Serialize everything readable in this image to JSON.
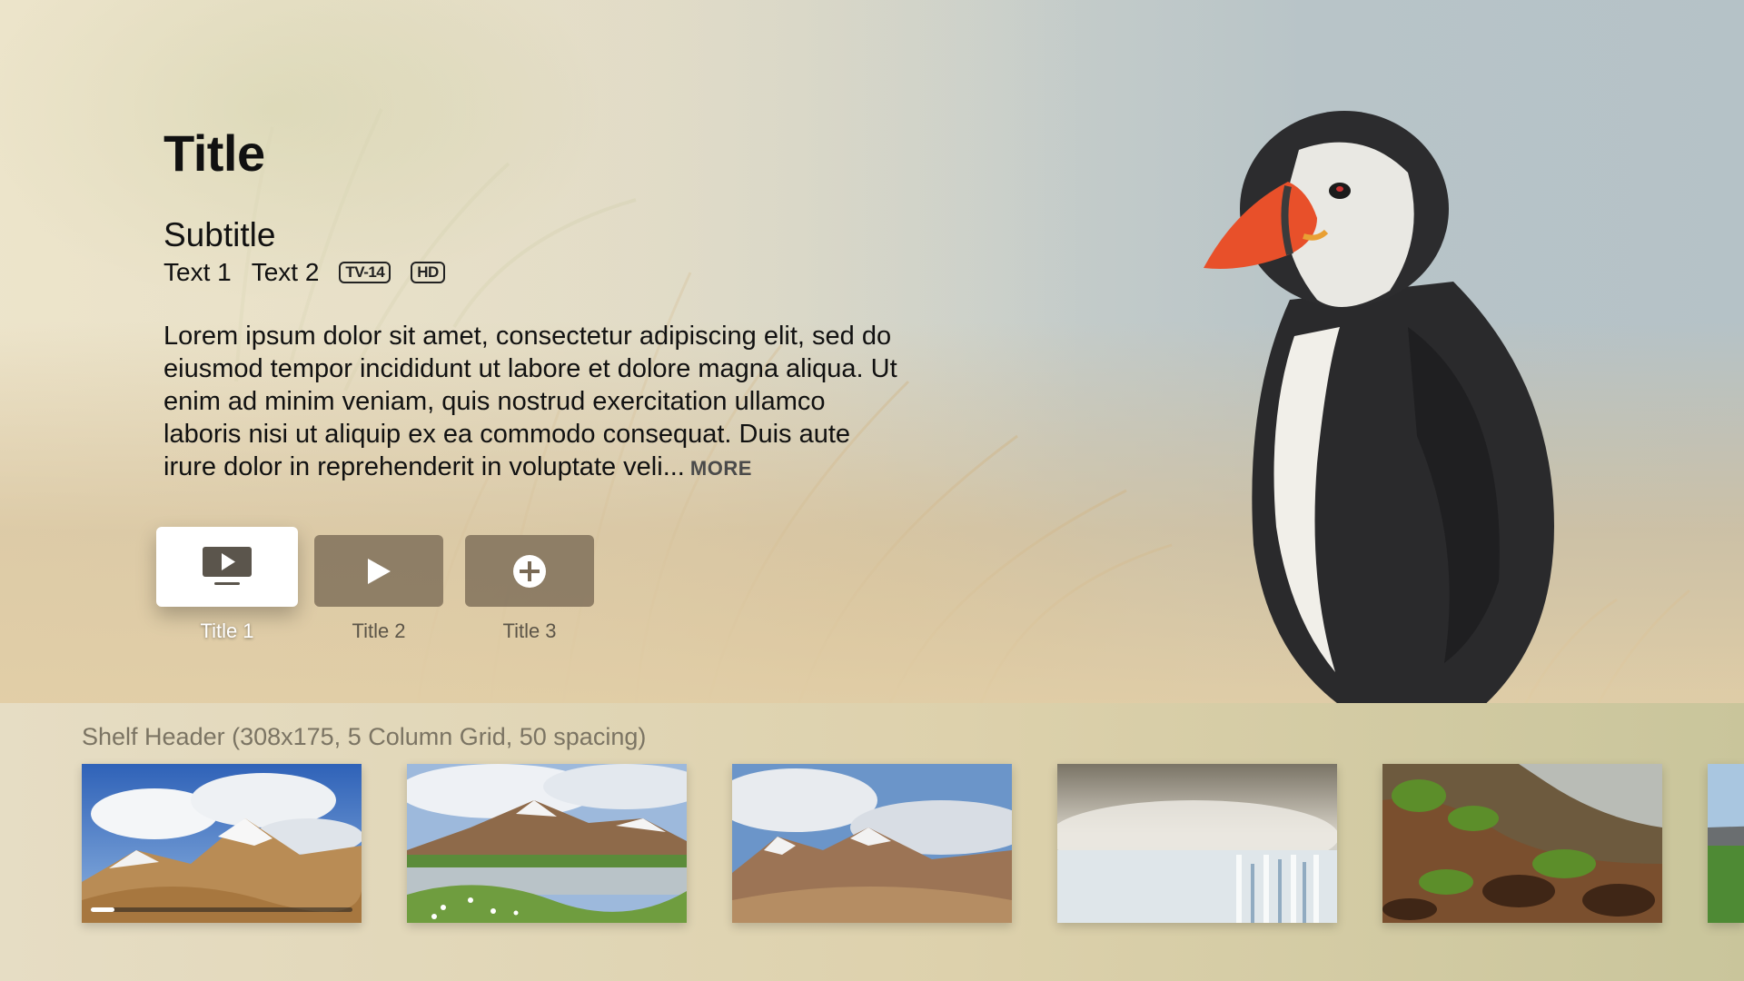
{
  "hero": {
    "title": "Title",
    "subtitle": "Subtitle",
    "text1": "Text 1",
    "text2": "Text 2",
    "rating_badge": "TV-14",
    "quality_badge": "HD",
    "description": "Lorem ipsum dolor sit amet, consectetur adipiscing elit, sed do eiusmod tempor incididunt ut labore et dolore magna aliqua. Ut enim ad minim veniam, quis nostrud exercitation ullamco laboris nisi ut aliquip ex ea commodo consequat. Duis aute irure dolor in reprehenderit in voluptate veli...",
    "more_label": "MORE",
    "background_image": "puffin-in-grass"
  },
  "actions": [
    {
      "label": "Title 1",
      "icon": "tv-play-icon",
      "focused": true
    },
    {
      "label": "Title 2",
      "icon": "play-icon",
      "focused": false
    },
    {
      "label": "Title 3",
      "icon": "plus-circle-icon",
      "focused": false
    }
  ],
  "shelf": {
    "header": "Shelf Header (308x175, 5 Column Grid, 50 spacing)",
    "items": [
      {
        "image": "mountain-snow-clouds",
        "progress": 0.09
      },
      {
        "image": "mountain-lake-reflection"
      },
      {
        "image": "mountain-range-clouds"
      },
      {
        "image": "misty-waterfall"
      },
      {
        "image": "rocky-shore-moss"
      },
      {
        "image": "green-valley-partial"
      }
    ]
  },
  "colors": {
    "focused_button": "#ffffff",
    "unfocused_button": "#786955",
    "title_text": "#111111",
    "shelf_header_text": "#7b7463"
  }
}
